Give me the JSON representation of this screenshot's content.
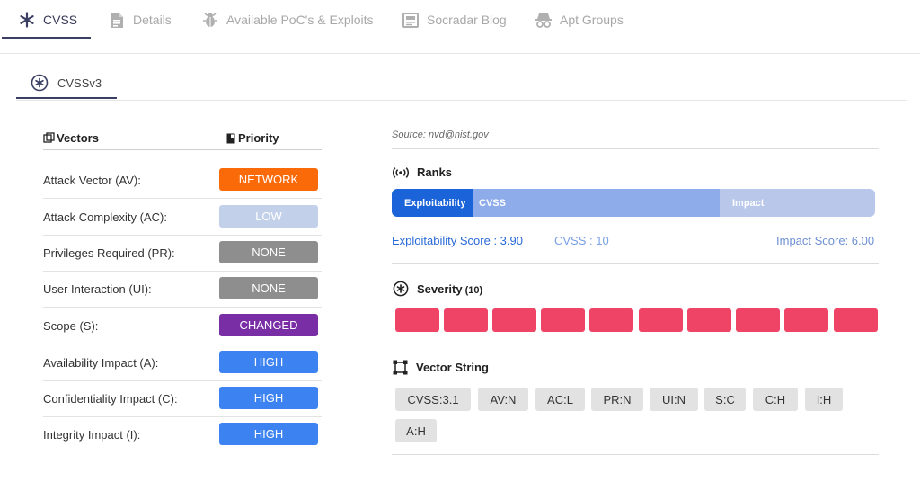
{
  "tabs": [
    {
      "label": "CVSS",
      "icon": "asterisk-icon"
    },
    {
      "label": "Details",
      "icon": "document-icon"
    },
    {
      "label": "Available PoC's & Exploits",
      "icon": "bug-icon"
    },
    {
      "label": "Socradar Blog",
      "icon": "newspaper-icon"
    },
    {
      "label": "Apt Groups",
      "icon": "spy-icon"
    }
  ],
  "subtab": {
    "label": "CVSSv3",
    "icon": "asterisk-circle-icon"
  },
  "vectors": {
    "header_vectors": "Vectors",
    "header_priority": "Priority",
    "rows": [
      {
        "label": "Attack Vector (AV):",
        "value": "NETWORK",
        "color": "#fb6a09"
      },
      {
        "label": "Attack Complexity (AC):",
        "value": "LOW",
        "color": "#c2d0ea"
      },
      {
        "label": "Privileges Required (PR):",
        "value": "NONE",
        "color": "#8e8e8e"
      },
      {
        "label": "User Interaction (UI):",
        "value": "NONE",
        "color": "#8e8e8e"
      },
      {
        "label": "Scope (S):",
        "value": "CHANGED",
        "color": "#7a2ea6"
      },
      {
        "label": "Availability Impact (A):",
        "value": "HIGH",
        "color": "#3c82f0"
      },
      {
        "label": "Confidentiality Impact (C):",
        "value": "HIGH",
        "color": "#3c82f0"
      },
      {
        "label": "Integrity Impact (I):",
        "value": "HIGH",
        "color": "#3c82f0"
      }
    ]
  },
  "source": "Source: nvd@nist.gov",
  "ranks": {
    "title": "Ranks",
    "bar": {
      "exploitability_label": "Exploitability",
      "cvss_label": "CVSS",
      "impact_label": "Impact"
    },
    "exploitability_score": "Exploitability Score : 3.90",
    "cvss_score": "CVSS : 10",
    "impact_score": "Impact Score: 6.00"
  },
  "severity": {
    "title": "Severity",
    "value": "(10)",
    "filled_boxes": 10,
    "color": "#f04466"
  },
  "vector_string": {
    "title": "Vector String",
    "chips": [
      "CVSS:3.1",
      "AV:N",
      "AC:L",
      "PR:N",
      "UI:N",
      "S:C",
      "C:H",
      "I:H",
      "A:H"
    ]
  },
  "colors": {
    "accent": "#3a3f63",
    "link_blue": "#2a6ad8",
    "light_blue": "#5b8fe0"
  }
}
